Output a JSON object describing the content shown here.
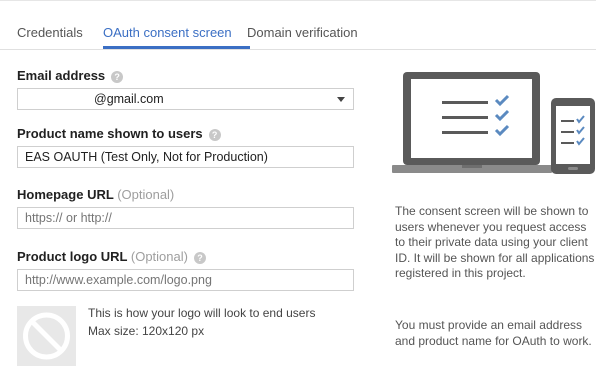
{
  "tabs": [
    {
      "label": "Credentials",
      "active": false
    },
    {
      "label": "OAuth consent screen",
      "active": true
    },
    {
      "label": "Domain verification",
      "active": false
    }
  ],
  "form": {
    "email": {
      "label": "Email address",
      "value": "@gmail.com"
    },
    "product_name": {
      "label": "Product name shown to users",
      "value": "EAS OAUTH (Test Only, Not for Production)"
    },
    "homepage": {
      "label": "Homepage URL",
      "optional": "(Optional)",
      "placeholder": "https:// or http://"
    },
    "logo": {
      "label": "Product logo URL",
      "optional": "(Optional)",
      "placeholder": "http://www.example.com/logo.png"
    },
    "logo_preview": {
      "line1": "This is how your logo will look to end users",
      "line2": "Max size: 120x120 px"
    }
  },
  "info": {
    "paragraph1": "The consent screen will be shown to users whenever you request access to their private data using your client ID. It will be shown for all applications registered in this project.",
    "paragraph2": "You must provide an email address and product name for OAuth to work."
  },
  "colors": {
    "accent": "#3b6fc4",
    "check": "#5b8ac0",
    "device": "#5a5a5a"
  },
  "icons": {
    "help": "question-circle-icon",
    "dropdown": "chevron-down-icon",
    "logo_placeholder": "no-image-icon",
    "illustration": "laptop-phone-checklist-illustration"
  }
}
